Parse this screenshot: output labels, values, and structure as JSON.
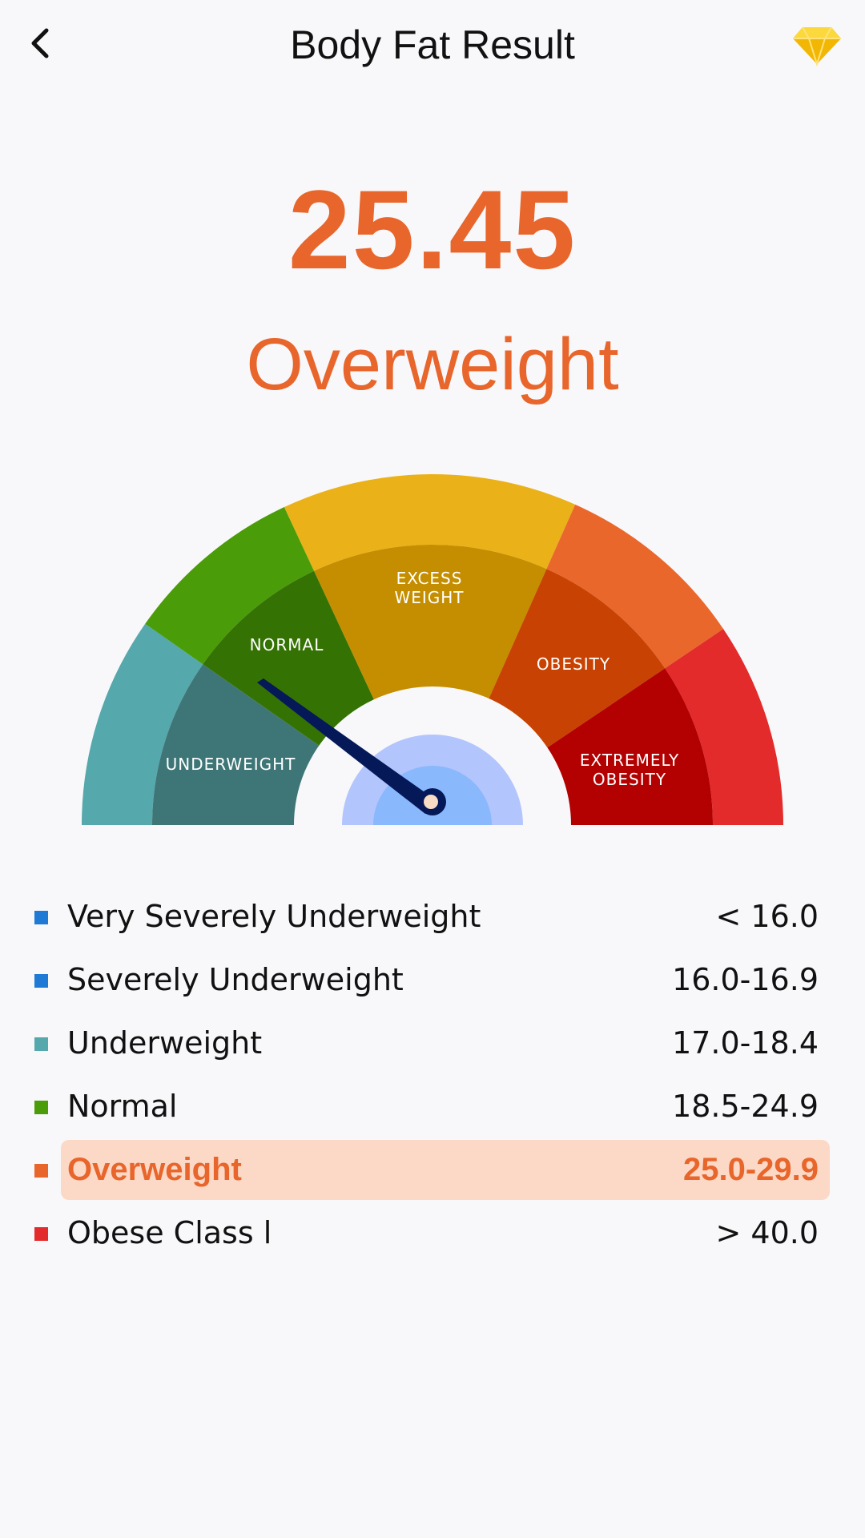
{
  "header": {
    "title": "Body Fat Result",
    "back_icon": "chevron-left-icon",
    "premium_icon": "diamond-icon"
  },
  "result": {
    "value": "25.45",
    "category": "Overweight",
    "color": "#e8652b"
  },
  "gauge": {
    "labels": {
      "underweight": "UNDERWEIGHT",
      "normal": "NORMAL",
      "excess_1": "EXCESS",
      "excess_2": "WEIGHT",
      "obesity": "OBESITY",
      "extreme_1": "EXTREMELY",
      "extreme_2": "OBESITY"
    },
    "colors": {
      "underweight": [
        "#55a8ab",
        "#3e7677"
      ],
      "normal": [
        "#4b9c09",
        "#347203"
      ],
      "excess": [
        "#ebb118",
        "#c58e00"
      ],
      "obesity": [
        "#ea672b",
        "#c84303"
      ],
      "extreme": [
        "#e32b2b",
        "#b30000"
      ],
      "needle": "#051858",
      "hub_outer": "#b3c5fd",
      "hub_inner": "#8ab8fc"
    }
  },
  "legend": [
    {
      "name": "Very Severely Underweight",
      "range": "< 16.0",
      "color": "#1f7ad6"
    },
    {
      "name": "Severely Underweight",
      "range": "16.0-16.9",
      "color": "#1f7ad6"
    },
    {
      "name": "Underweight",
      "range": "17.0-18.4",
      "color": "#55a8ab"
    },
    {
      "name": "Normal",
      "range": "18.5-24.9",
      "color": "#4b9c09"
    },
    {
      "name": "Overweight",
      "range": "25.0-29.9",
      "color": "#e8652b",
      "active": true
    },
    {
      "name": "Obese Class l",
      "range": "> 40.0",
      "color": "#e32b2b"
    }
  ]
}
